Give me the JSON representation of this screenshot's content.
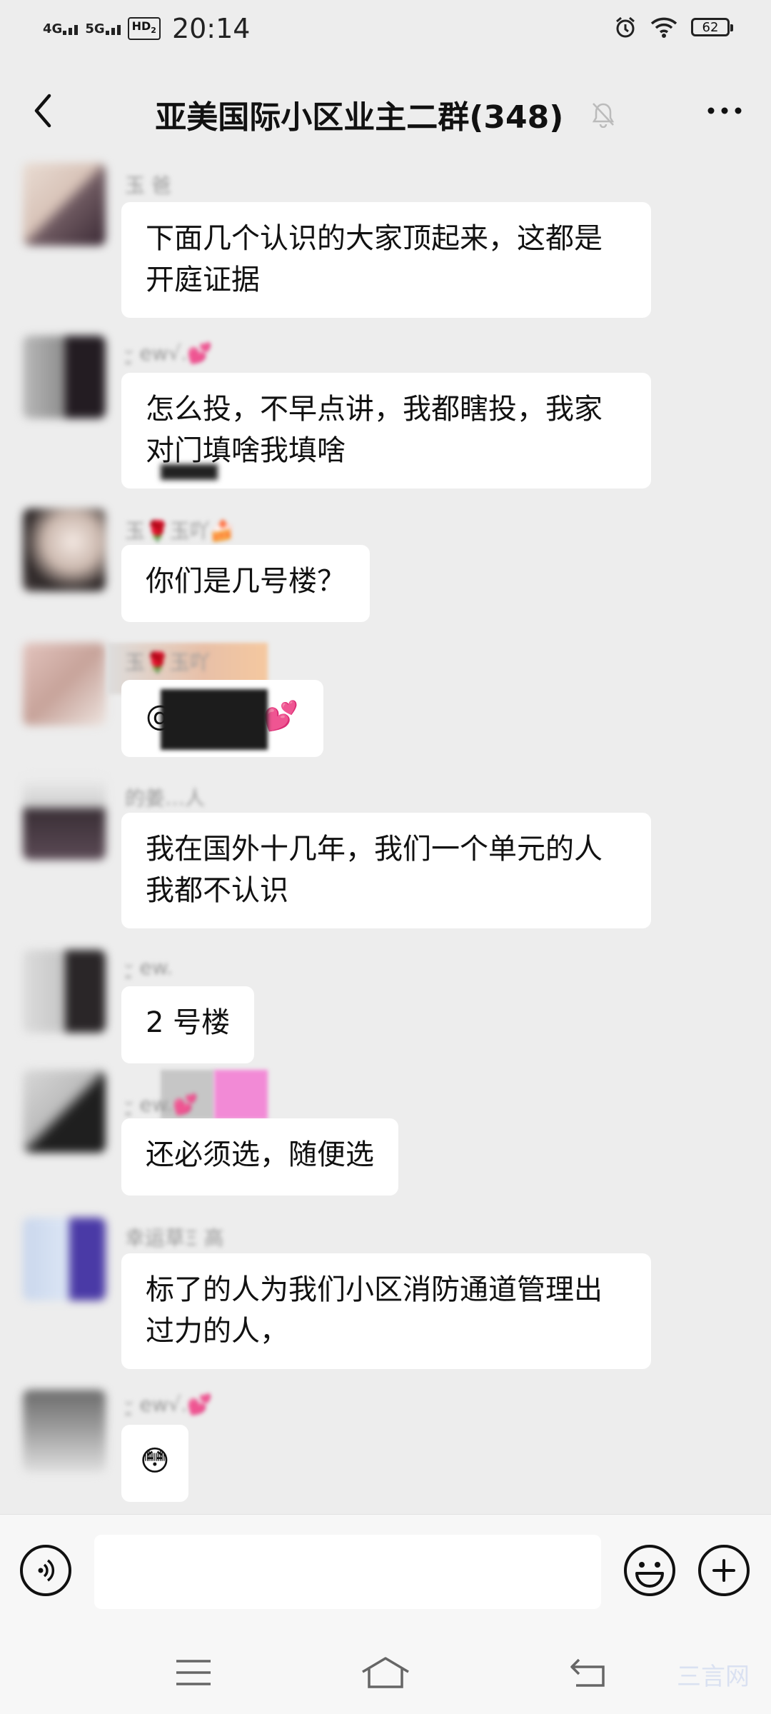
{
  "status_bar": {
    "network1": "4G",
    "network2": "5G",
    "hd_label": "HD",
    "hd_sub": "2",
    "time": "20:14",
    "battery": "62"
  },
  "header": {
    "title": "亚美国际小区业主二群(348)",
    "back_icon": "chevron-left-icon",
    "mute_icon": "bell-off-icon",
    "more_icon": "more-dots-icon"
  },
  "messages": [
    {
      "sender": "玉 爸",
      "text": "下面几个认识的大家顶起来，这都是开庭证据"
    },
    {
      "sender": "ᵕ͈ ew√.💕",
      "text": "怎么投，不早点讲，我都瞎投，我家对门填啥我填啥"
    },
    {
      "sender": "玉🌹玉吖🍰",
      "text": "你们是几号楼？"
    },
    {
      "sender": "玉🌹玉吖",
      "text": "@ᵕ͈ ew√.💕"
    },
    {
      "sender": "的姜…人",
      "text": "我在国外十几年，我们一个单元的人我都不认识"
    },
    {
      "sender": "ᵕ͈ ew.",
      "text": "2 号楼"
    },
    {
      "sender": "ᵕ͈ ew.💕",
      "text": "还必须选，随便选"
    },
    {
      "sender": "幸运草Ξ 高",
      "text": "标了的人为我们小区消防通道管理出过力的人，"
    },
    {
      "sender": "ᵕ͈ ew√.💕",
      "text": "😳"
    }
  ],
  "input_bar": {
    "voice_icon": "voice-icon",
    "emoji_icon": "emoji-icon",
    "plus_icon": "plus-icon"
  },
  "nav_bar": {
    "menu_icon": "menu-icon",
    "home_icon": "home-icon",
    "back_icon": "back-icon",
    "watermark": "三言网"
  }
}
